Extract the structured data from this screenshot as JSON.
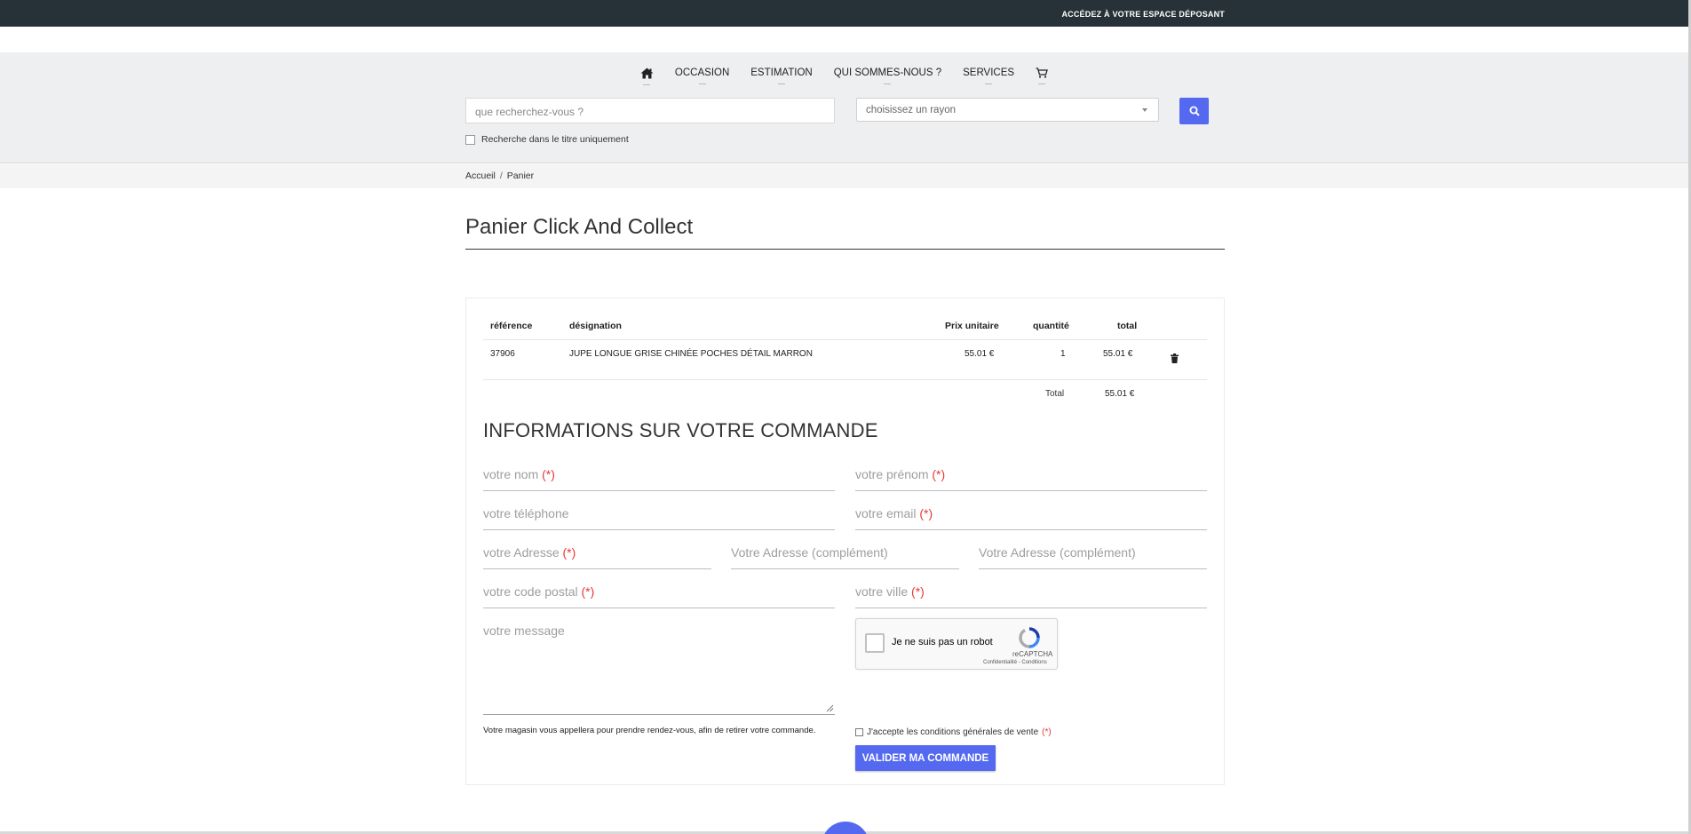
{
  "topbar": {
    "depositor_link": "ACCÉDEZ À VOTRE ESPACE DÉPOSANT"
  },
  "menu": {
    "home_icon": "home-icon",
    "items": [
      "OCCASION",
      "ESTIMATION",
      "QUI SOMMES-NOUS ?",
      "SERVICES"
    ],
    "cart_icon": "cart-icon"
  },
  "search": {
    "placeholder": "que recherchez-vous ?",
    "rayon_placeholder": "choisissez un rayon",
    "title_only_label": "Recherche dans le titre uniquement",
    "button_icon": "search-icon"
  },
  "breadcrumb": {
    "home": "Accueil",
    "separator": "/",
    "current": "Panier"
  },
  "page": {
    "title": "Panier Click And Collect"
  },
  "cart": {
    "headers": {
      "reference": "référence",
      "designation": "désignation",
      "unit_price": "Prix unitaire",
      "quantity": "quantité",
      "total": "total"
    },
    "rows": [
      {
        "reference": "37906",
        "designation": "JUPE LONGUE GRISE CHINÉE POCHES DÉTAIL MARRON",
        "unit_price": "55.01 €",
        "quantity": "1",
        "total": "55.01 €",
        "action_icon": "trash-icon"
      }
    ],
    "total_label": "Total",
    "total_value": "55.01 €"
  },
  "form": {
    "section_title": "INFORMATIONS SUR VOTRE COMMANDE",
    "required_mark": "(*)",
    "nom": "votre nom",
    "prenom": "votre prénom",
    "telephone": "votre téléphone",
    "email": "votre email",
    "adresse": "votre Adresse",
    "adresse_complement_1": "Votre Adresse (complément)",
    "adresse_complement_2": "Votre Adresse (complément)",
    "code_postal": "votre code postal",
    "ville": "votre ville",
    "message": "votre message",
    "recaptcha_label": "Je ne suis pas un robot",
    "recaptcha_brand": "reCAPTCHA",
    "recaptcha_links": "Confidentialité - Conditions",
    "store_note": "Votre magasin vous appellera pour prendre rendez-vous, afin de retirer votre commande.",
    "terms_label": "J'accepte les conditions générales de vente",
    "submit_label": "VALIDER MA COMMANDE"
  },
  "colors": {
    "accent": "#5469f0",
    "topbar": "#263238",
    "required": "#e53935",
    "nav_bg": "#eeeff1"
  }
}
